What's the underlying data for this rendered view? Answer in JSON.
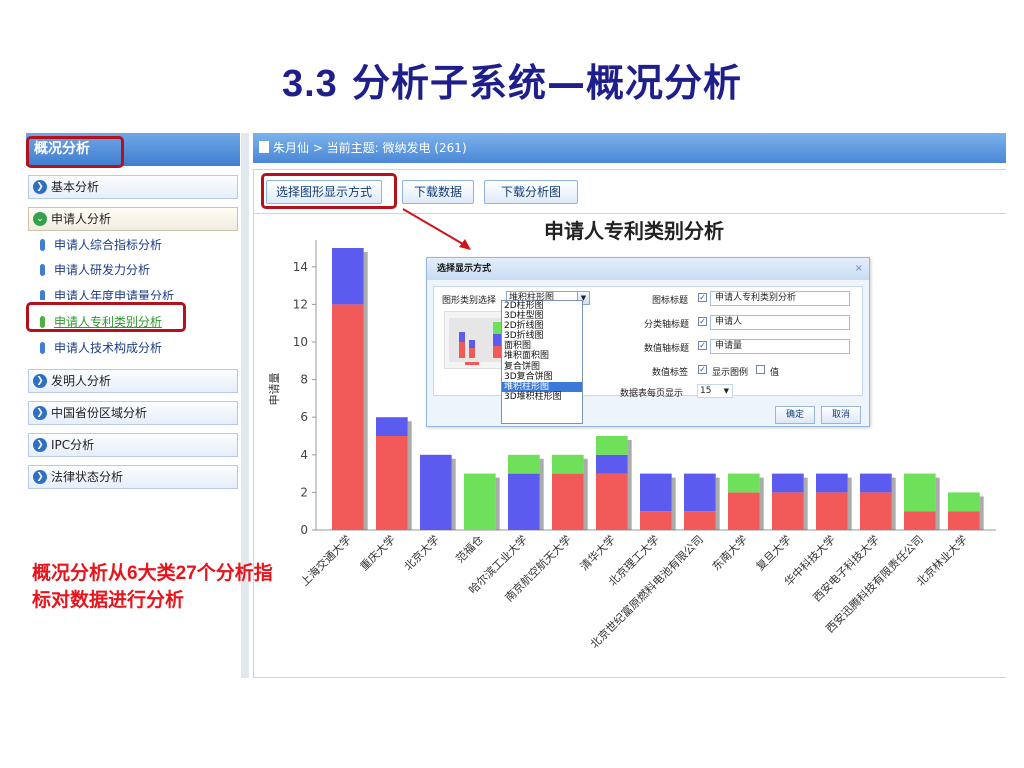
{
  "slide": {
    "title_num": "3.3",
    "title_text": "分析子系统—概况分析",
    "note_parts": [
      "概况分析从",
      "6",
      "大类",
      "27",
      "个分析指标对数据进行分析"
    ]
  },
  "sidebar": {
    "header": "概况分析",
    "groups": [
      {
        "label": "基本分析",
        "open": false
      },
      {
        "label": "申请人分析",
        "open": true
      },
      {
        "label": "发明人分析",
        "open": false
      },
      {
        "label": "中国省份区域分析",
        "open": false
      },
      {
        "label": "IPC分析",
        "open": false
      },
      {
        "label": "法律状态分析",
        "open": false
      }
    ],
    "sub_items": [
      {
        "label": "申请人综合指标分析",
        "active": false
      },
      {
        "label": "申请人研发力分析",
        "active": false
      },
      {
        "label": "申请人年度申请量分析",
        "active": false
      },
      {
        "label": "申请人专利类别分析",
        "active": true
      },
      {
        "label": "申请人技术构成分析",
        "active": false
      }
    ]
  },
  "topbar": {
    "breadcrumb": "朱月仙 > 当前主题: 微纳发电 (261)"
  },
  "toolbar": {
    "select_display": "选择图形显示方式",
    "download_data": "下载数据",
    "download_chart": "下载分析图"
  },
  "dialog": {
    "title": "选择显示方式",
    "close": "×",
    "chart_type_label": "图形类别选择",
    "chart_type_value": "堆积柱形图",
    "chart_type_options": [
      "2D柱形图",
      "3D柱型图",
      "2D折线图",
      "3D折线图",
      "面积图",
      "堆积面积图",
      "复合饼图",
      "3D复合饼图",
      "堆积柱形图",
      "3D堆积柱形图"
    ],
    "chart_title_label": "图标标题",
    "chart_title_value": "申请人专利类别分析",
    "category_axis_label": "分类轴标题",
    "category_axis_value": "申请人",
    "value_axis_label": "数值轴标题",
    "value_axis_value": "申请量",
    "value_tag_label": "数值标签",
    "show_legend": "显示图例",
    "show_value": "值",
    "per_page_label": "数据表每页显示",
    "per_page_value": "15",
    "ok": "确定",
    "cancel": "取消"
  },
  "colors": {
    "red": "#f25a5a",
    "blue": "#5b5bf0",
    "green": "#6fe05a",
    "highlight": "#b3121c",
    "note": "#e8141c"
  },
  "chart_data": {
    "type": "bar",
    "title": "申请人专利类别分析",
    "ylabel": "申请量",
    "ylim": [
      0,
      15
    ],
    "yticks": [
      0,
      2,
      4,
      6,
      8,
      10,
      12,
      14
    ],
    "categories": [
      "上海交通大学",
      "重庆大学",
      "北京大学",
      "范福仓",
      "哈尔滨工业大学",
      "南京航空航天大学",
      "清华大学",
      "北京理工大学",
      "北京世纪富原燃料电池有限公司",
      "东南大学",
      "复旦大学",
      "华中科技大学",
      "西安电子科技大学",
      "西安迅腾科技有限责任公司",
      "北京林业大学"
    ],
    "series": [
      {
        "color": "#f25a5a",
        "values": [
          12,
          5,
          0,
          0,
          0,
          3,
          3,
          1,
          1,
          2,
          2,
          2,
          2,
          1,
          1
        ]
      },
      {
        "color": "#5b5bf0",
        "values": [
          3,
          1,
          4,
          0,
          3,
          0,
          1,
          2,
          2,
          0,
          1,
          1,
          1,
          0,
          0
        ]
      },
      {
        "color": "#6fe05a",
        "values": [
          0,
          0,
          0,
          3,
          1,
          1,
          1,
          0,
          0,
          1,
          0,
          0,
          0,
          2,
          1
        ]
      }
    ]
  }
}
